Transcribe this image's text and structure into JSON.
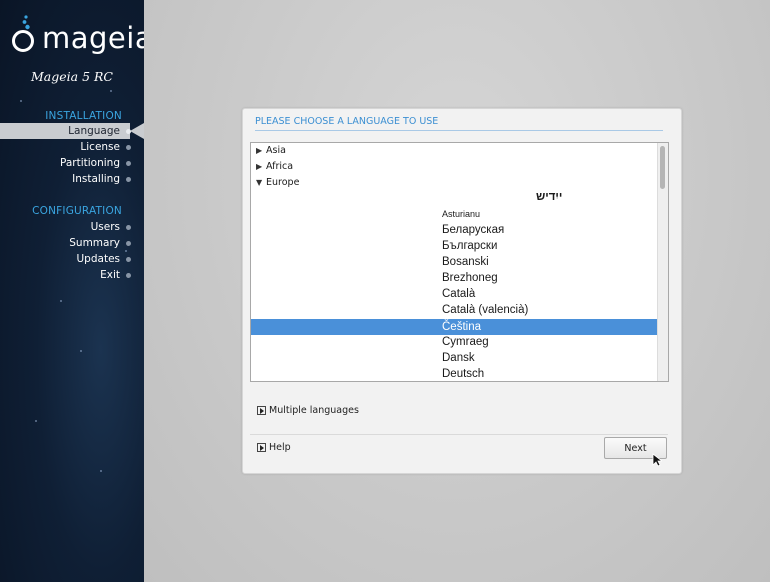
{
  "sidebar": {
    "brand": "mageia",
    "version": "Mageia 5 RC",
    "installation_title": "INSTALLATION",
    "installation_steps": [
      {
        "label": "Language",
        "active": true
      },
      {
        "label": "License"
      },
      {
        "label": "Partitioning"
      },
      {
        "label": "Installing"
      }
    ],
    "configuration_title": "CONFIGURATION",
    "configuration_steps": [
      {
        "label": "Users"
      },
      {
        "label": "Summary"
      },
      {
        "label": "Updates"
      },
      {
        "label": "Exit"
      }
    ]
  },
  "dialog": {
    "title": "PLEASE CHOOSE A LANGUAGE TO USE",
    "groups": [
      {
        "label": "Asia",
        "expanded": false
      },
      {
        "label": "Africa",
        "expanded": false
      },
      {
        "label": "Europe",
        "expanded": true
      }
    ],
    "languages": [
      "ייִדיש",
      "Asturianu",
      "Беларуская",
      "Български",
      "Bosanski",
      "Brezhoneg",
      "Català",
      "Català (valencià)",
      "Čeština",
      "Cymraeg",
      "Dansk",
      "Deutsch"
    ],
    "selected_language": "Čeština",
    "multiple_languages_label": "Multiple languages",
    "help_label": "Help",
    "next_label": "Next"
  },
  "colors": {
    "accent": "#3aa5e0",
    "selection": "#4a90d9",
    "sidebar_bg": "#0f1f35"
  },
  "icons": [
    "expander-arrow-icon",
    "mouse-cursor-icon",
    "mageia-logo-icon"
  ]
}
